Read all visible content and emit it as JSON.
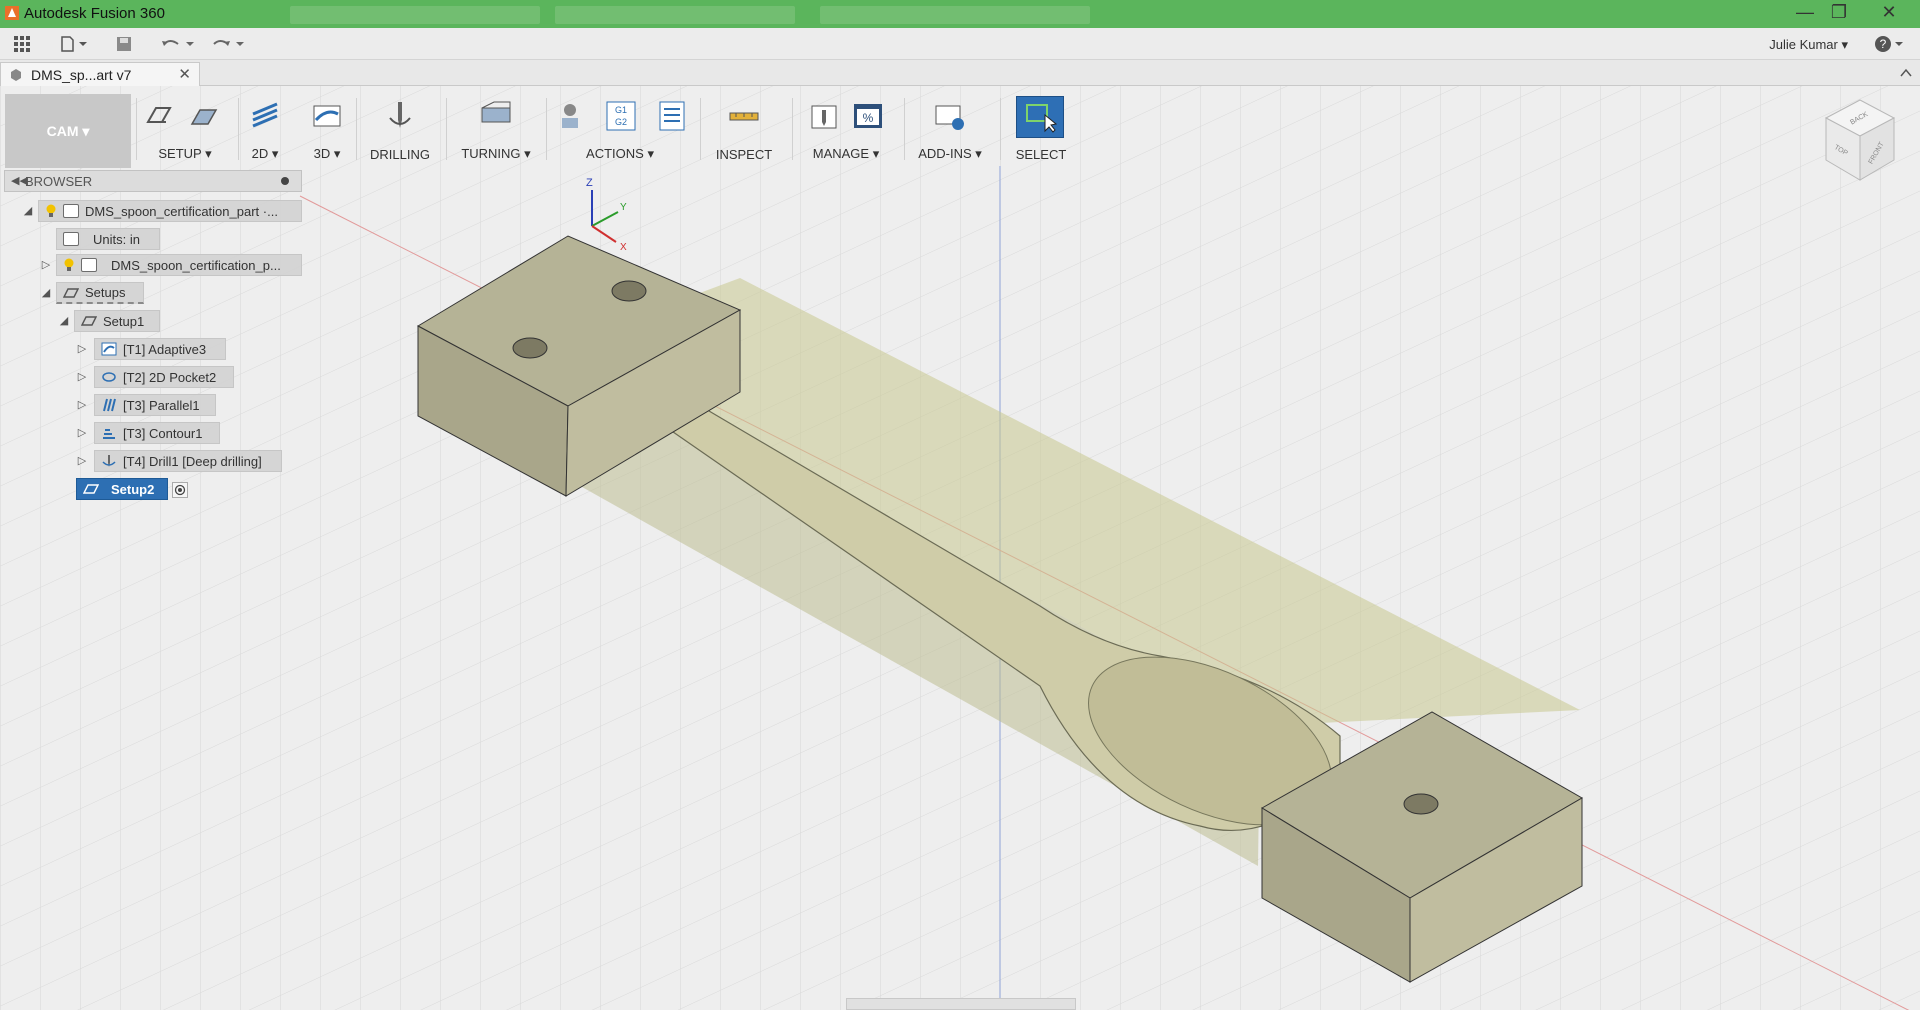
{
  "window": {
    "title": "Autodesk Fusion 360"
  },
  "quick_access": {
    "user": "Julie Kumar",
    "help": "?"
  },
  "document_tab": {
    "label": "DMS_sp...art v7"
  },
  "toolbar": {
    "workspace": "CAM",
    "groups": [
      {
        "id": "setup",
        "label": "SETUP",
        "dropdown": true
      },
      {
        "id": "2d",
        "label": "2D",
        "dropdown": true
      },
      {
        "id": "3d",
        "label": "3D",
        "dropdown": true
      },
      {
        "id": "drilling",
        "label": "DRILLING",
        "dropdown": false
      },
      {
        "id": "turning",
        "label": "TURNING",
        "dropdown": true
      },
      {
        "id": "actions",
        "label": "ACTIONS",
        "dropdown": true
      },
      {
        "id": "inspect",
        "label": "INSPECT",
        "dropdown": false
      },
      {
        "id": "manage",
        "label": "MANAGE",
        "dropdown": true
      },
      {
        "id": "addins",
        "label": "ADD-INS",
        "dropdown": true
      },
      {
        "id": "select",
        "label": "SELECT",
        "dropdown": false
      }
    ],
    "actions_icon_text": [
      "G1",
      "G2"
    ],
    "manage_icon_text": "%"
  },
  "browser": {
    "title": "BROWSER",
    "root": "DMS_spoon_certification_part ·...",
    "units": "Units: in",
    "component": "DMS_spoon_certification_p...",
    "setups": "Setups",
    "setup1": "Setup1",
    "operations": [
      "[T1] Adaptive3",
      "[T2] 2D Pocket2",
      "[T3] Parallel1",
      "[T3] Contour1",
      "[T4] Drill1 [Deep drilling]"
    ],
    "setup2": "Setup2"
  },
  "viewcube": {
    "faces": [
      "TOP",
      "FRONT",
      "BACK"
    ]
  },
  "axes": {
    "x": "X",
    "y": "Y",
    "z": "Z"
  },
  "colors": {
    "accent": "#2d6fb3",
    "titlebar": "#5bb55c",
    "stock": "#b9b58f"
  }
}
